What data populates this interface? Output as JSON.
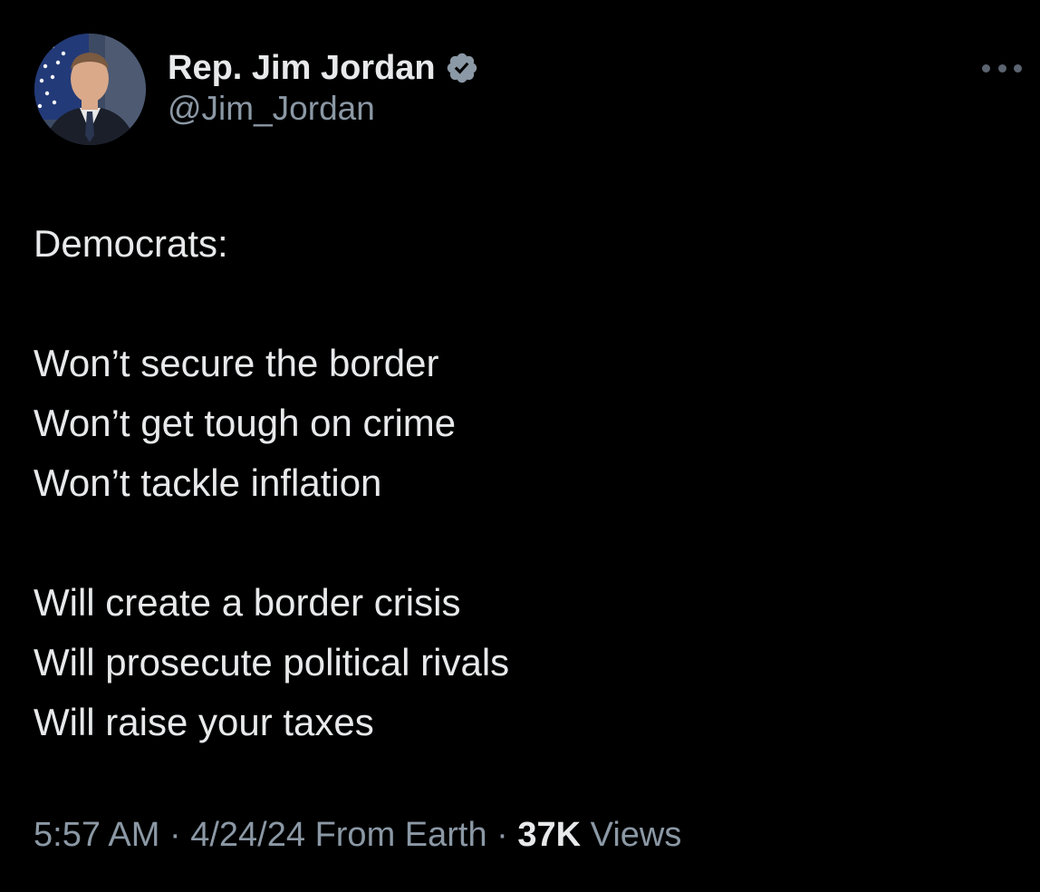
{
  "author": {
    "display_name": "Rep. Jim Jordan",
    "handle": "@Jim_Jordan",
    "verified_icon": "verified-badge-icon",
    "avatar_icon": "profile-photo"
  },
  "more_icon": "more-horizontal-icon",
  "tweet": {
    "lines": [
      "Democrats:",
      "",
      "Won’t secure the border",
      "Won’t get tough on crime",
      "Won’t tackle inflation",
      "",
      "Will create a border crisis",
      "Will prosecute political rivals",
      "Will raise your taxes"
    ]
  },
  "meta": {
    "time": "5:57 AM",
    "separator": "·",
    "date": "4/24/24",
    "location": "From Earth",
    "views_count": "37K",
    "views_label": "Views"
  },
  "colors": {
    "background": "#000000",
    "primary_text": "#e7e9ea",
    "secondary_text": "#8b98a5",
    "verified_badge": "#8b98a5"
  }
}
